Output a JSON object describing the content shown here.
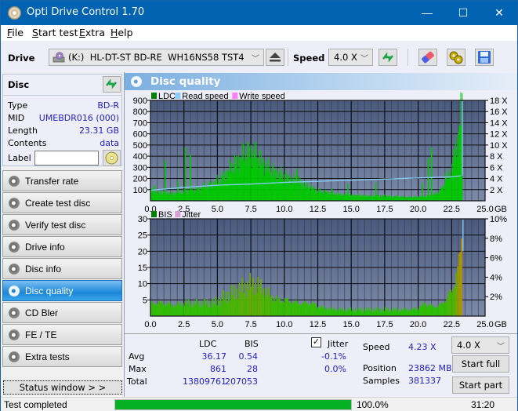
{
  "window": {
    "title": "Opti Drive Control 1.70",
    "controls": {
      "minimize": "—",
      "maximize": "☐",
      "close": "✕"
    }
  },
  "menu": [
    {
      "label": "File",
      "accel": "F",
      "rest": "ile"
    },
    {
      "label": "Start test",
      "accel": "S",
      "rest": "tart test"
    },
    {
      "label": "Extra",
      "accel": "E",
      "rest": "xtra",
      "pre": ""
    },
    {
      "label": "Help",
      "accel": "H",
      "rest": "elp"
    }
  ],
  "toolbar": {
    "drive_label": "Drive",
    "drive_value": "(K:)  HL-DT-ST BD-RE  WH16NS58 TST4",
    "speed_label": "Speed",
    "speed_value": "4.0 X"
  },
  "disc": {
    "header": "Disc",
    "rows": [
      {
        "key": "Type",
        "value": "BD-R"
      },
      {
        "key": "MID",
        "value": "UMEBDR016 (000)"
      },
      {
        "key": "Length",
        "value": "23.31 GB"
      },
      {
        "key": "Contents",
        "value": "data"
      }
    ],
    "label_key": "Label",
    "label_value": ""
  },
  "nav": [
    {
      "label": "Transfer rate",
      "active": false
    },
    {
      "label": "Create test disc",
      "active": false
    },
    {
      "label": "Verify test disc",
      "active": false
    },
    {
      "label": "Drive info",
      "active": false
    },
    {
      "label": "Disc info",
      "active": false
    },
    {
      "label": "Disc quality",
      "active": true
    },
    {
      "label": "CD Bler",
      "active": false
    },
    {
      "label": "FE / TE",
      "active": false
    },
    {
      "label": "Extra tests",
      "active": false
    }
  ],
  "status_window_button": "Status window > >",
  "panel_title": "Disc quality",
  "chart_data": [
    {
      "type": "area",
      "title": "LDC / Read speed",
      "legend": [
        "LDC",
        "Read speed",
        "Write speed"
      ],
      "legend_colors": [
        "#008000",
        "#87cefa",
        "#ff80ff"
      ],
      "xlabel": "GB",
      "xlim": [
        0,
        25
      ],
      "x_ticks": [
        "0.0",
        "2.5",
        "5.0",
        "7.5",
        "10.0",
        "12.5",
        "15.0",
        "17.5",
        "20.0",
        "22.5",
        "25.0"
      ],
      "ylim_left": [
        0,
        900
      ],
      "y_ticks_left": [
        "100",
        "200",
        "300",
        "400",
        "500",
        "600",
        "700",
        "800",
        "900"
      ],
      "ylim_right": [
        0,
        18
      ],
      "y_ticks_right": [
        "2 X",
        "4 X",
        "6 X",
        "8 X",
        "10 X",
        "12 X",
        "14 X",
        "16 X",
        "18 X"
      ],
      "grid": true,
      "series": [
        {
          "name": "LDC",
          "x": [
            0,
            0.5,
            1,
            1.5,
            2,
            2.5,
            3,
            3.5,
            4,
            4.5,
            5,
            5.5,
            6,
            6.5,
            7,
            7.5,
            8,
            8.5,
            9,
            9.5,
            10,
            10.5,
            11,
            11.5,
            12,
            12.5,
            13,
            13.5,
            14,
            14.5,
            15,
            15.5,
            16,
            16.5,
            17,
            17.5,
            18,
            18.5,
            19,
            19.5,
            20,
            20.5,
            21,
            21.5,
            22,
            22.5,
            23,
            23.3
          ],
          "values": [
            95,
            80,
            75,
            70,
            70,
            90,
            100,
            110,
            130,
            150,
            180,
            230,
            300,
            360,
            420,
            440,
            400,
            320,
            280,
            250,
            220,
            200,
            180,
            150,
            120,
            90,
            80,
            70,
            60,
            55,
            50,
            50,
            45,
            45,
            45,
            45,
            40,
            40,
            35,
            35,
            35,
            40,
            50,
            80,
            150,
            300,
            600,
            861
          ]
        },
        {
          "name": "LDC spikes",
          "x": [
            0.25,
            1.05,
            2.0,
            2.55,
            2.95,
            10.9,
            13.5,
            14.7,
            16.8,
            20.25,
            20.7,
            20.95,
            22.0
          ],
          "values": [
            140,
            360,
            180,
            480,
            420,
            290,
            110,
            150,
            160,
            160,
            380,
            480,
            250
          ]
        },
        {
          "name": "Read speed",
          "x": [
            0,
            2.5,
            5,
            7.5,
            10,
            12.5,
            15,
            17.5,
            20,
            22.5,
            23.3
          ],
          "values": [
            1.9,
            2.4,
            2.8,
            3.0,
            3.3,
            3.5,
            3.7,
            3.9,
            4.1,
            4.3,
            4.5
          ]
        }
      ]
    },
    {
      "type": "area",
      "title": "BIS / Jitter",
      "legend": [
        "BIS",
        "Jitter"
      ],
      "legend_colors": [
        "#008000",
        "#d8a0d8"
      ],
      "xlabel": "GB",
      "xlim": [
        0,
        25
      ],
      "x_ticks": [
        "0.0",
        "2.5",
        "5.0",
        "7.5",
        "10.0",
        "12.5",
        "15.0",
        "17.5",
        "20.0",
        "22.5",
        "25.0"
      ],
      "ylim_left": [
        0,
        30
      ],
      "y_ticks_left": [
        "5",
        "10",
        "15",
        "20",
        "25",
        "30"
      ],
      "ylim_right": [
        0,
        10
      ],
      "y_ticks_right": [
        "2%",
        "4%",
        "6%",
        "8%",
        "10%"
      ],
      "grid": true,
      "series": [
        {
          "name": "BIS",
          "x": [
            0,
            0.5,
            1,
            1.5,
            2,
            2.5,
            3,
            3.5,
            4,
            4.5,
            5,
            5.5,
            6,
            6.5,
            7,
            7.5,
            8,
            8.5,
            9,
            9.5,
            10,
            10.5,
            11,
            11.5,
            12,
            12.5,
            13,
            13.5,
            14,
            14.5,
            15,
            15.5,
            16,
            16.5,
            17,
            17.5,
            18,
            18.5,
            19,
            19.5,
            20,
            20.5,
            21,
            21.5,
            22,
            22.5,
            23,
            23.3
          ],
          "values": [
            4,
            4,
            4,
            3.5,
            3.5,
            4,
            4,
            4,
            4,
            4,
            4.5,
            6,
            7,
            8,
            9,
            10,
            9.5,
            8,
            6,
            5,
            5,
            4.5,
            4,
            4,
            4,
            3,
            2.5,
            2.2,
            2,
            2,
            2,
            2,
            2,
            2,
            2,
            2,
            2,
            2,
            2,
            2,
            2.5,
            4,
            3,
            3,
            5,
            8,
            16,
            28
          ]
        },
        {
          "name": "Jitter",
          "values": []
        }
      ]
    }
  ],
  "stats": {
    "col_ldc": "LDC",
    "col_bis": "BIS",
    "jitter_label": "Jitter",
    "jitter_checked": true,
    "rows": [
      {
        "label": "Avg",
        "ldc": "36.17",
        "bis": "0.54",
        "jitter": "-0.1%"
      },
      {
        "label": "Max",
        "ldc": "861",
        "bis": "28",
        "jitter": "0.0%"
      },
      {
        "label": "Total",
        "ldc": "13809761",
        "bis": "207053",
        "jitter": ""
      }
    ],
    "speed_label": "Speed",
    "speed_value": "4.23 X",
    "position_label": "Position",
    "position_value": "23862 MB",
    "samples_label": "Samples",
    "samples_value": "381337",
    "speed_select": "4.0 X",
    "start_full": "Start full",
    "start_part": "Start part"
  },
  "statusbar": {
    "text": "Test completed",
    "progress_percent": 100,
    "progress_label": "100.0%",
    "time": "31:20"
  }
}
